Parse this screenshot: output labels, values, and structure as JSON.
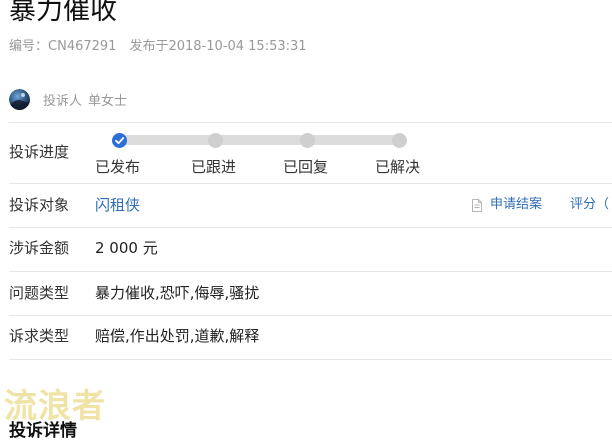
{
  "complaint": {
    "title": "暴力催收",
    "number_label": "编号：",
    "number": "CN467291",
    "published_label": "发布于",
    "published_at": "2018-10-04 15:53:31"
  },
  "complainant": {
    "label": "投诉人",
    "name": "单女士"
  },
  "progress": {
    "label": "投诉进度",
    "steps": [
      "已发布",
      "已跟进",
      "已回复",
      "已解决"
    ],
    "completed_steps": 1
  },
  "details": {
    "target_label": "投诉对象",
    "target_value": "闪租侠",
    "amount_label": "涉诉金额",
    "amount_value": "2 000 元",
    "issue_label": "问题类型",
    "issue_value": "暴力催收,恐吓,侮辱,骚扰",
    "demand_label": "诉求类型",
    "demand_value": "赔偿,作出处罚,道歉,解释"
  },
  "actions": {
    "settle_label": "申请结案",
    "rate_label": "评分（"
  },
  "watermark": "流浪者",
  "section": {
    "title": "投诉详情"
  },
  "colors": {
    "accent": "#2e6fd6",
    "link": "#2f6db5",
    "track": "#dcdcdc",
    "muted_text": "#999999"
  },
  "icons": {
    "check": "check-icon",
    "document": "document-icon",
    "avatar": "avatar-image"
  }
}
